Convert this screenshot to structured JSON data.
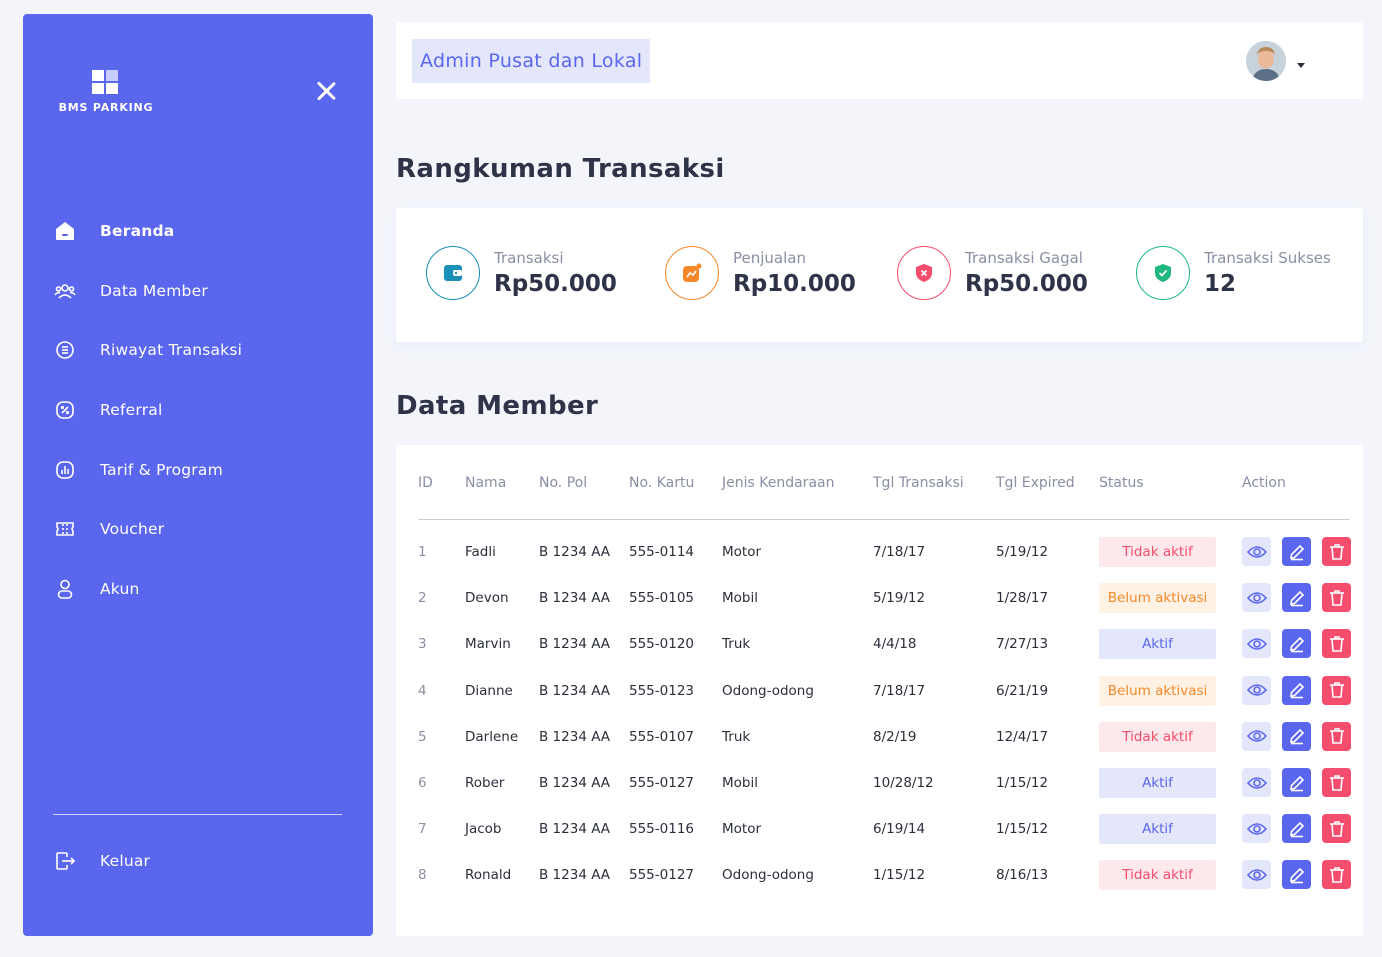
{
  "sidebar": {
    "brand": "BMS PARKING",
    "items": [
      {
        "label": "Beranda",
        "icon": "home-icon"
      },
      {
        "label": "Data Member",
        "icon": "users-icon"
      },
      {
        "label": "Riwayat Transaksi",
        "icon": "history-icon"
      },
      {
        "label": "Referral",
        "icon": "percent-icon"
      },
      {
        "label": "Tarif & Program",
        "icon": "chart-icon"
      },
      {
        "label": "Voucher",
        "icon": "ticket-icon"
      },
      {
        "label": "Akun",
        "icon": "user-icon"
      }
    ],
    "active_item": "Beranda",
    "logout_label": "Keluar"
  },
  "header": {
    "title": "Admin Pusat dan Lokal"
  },
  "summary": {
    "title": "Rangkuman Transaksi",
    "cards": [
      {
        "label": "Transaksi",
        "value": "Rp50.000",
        "icon": "wallet-icon",
        "color": "#1a8fb8"
      },
      {
        "label": "Penjualan",
        "value": "Rp10.000",
        "icon": "sales-chart-icon",
        "color": "#f6882a"
      },
      {
        "label": "Transaksi Gagal",
        "value": "Rp50.000",
        "icon": "shield-x-icon",
        "color": "#f44d6e"
      },
      {
        "label": "Transaksi Sukses",
        "value": "12",
        "icon": "shield-check-icon",
        "color": "#1fb980"
      }
    ]
  },
  "members": {
    "title": "Data Member",
    "columns": [
      "ID",
      "Nama",
      "No. Pol",
      "No. Kartu",
      "Jenis Kendaraan",
      "Tgl Transaksi",
      "Tgl Expired",
      "Status",
      "Action"
    ],
    "rows": [
      {
        "id": "1",
        "nama": "Fadli",
        "nopol": "B 1234 AA",
        "kartu": "555-0114",
        "jenis": "Motor",
        "tgl_transaksi": "7/18/17",
        "tgl_expired": "5/19/12",
        "status": "Tidak aktif"
      },
      {
        "id": "2",
        "nama": "Devon",
        "nopol": "B 1234 AA",
        "kartu": "555-0105",
        "jenis": "Mobil",
        "tgl_transaksi": "5/19/12",
        "tgl_expired": "1/28/17",
        "status": "Belum aktivasi"
      },
      {
        "id": "3",
        "nama": "Marvin",
        "nopol": "B 1234 AA",
        "kartu": "555-0120",
        "jenis": "Truk",
        "tgl_transaksi": "4/4/18",
        "tgl_expired": "7/27/13",
        "status": "Aktif"
      },
      {
        "id": "4",
        "nama": "Dianne",
        "nopol": "B 1234 AA",
        "kartu": "555-0123",
        "jenis": "Odong-odong",
        "tgl_transaksi": "7/18/17",
        "tgl_expired": "6/21/19",
        "status": "Belum aktivasi"
      },
      {
        "id": "5",
        "nama": "Darlene",
        "nopol": "B 1234 AA",
        "kartu": "555-0107",
        "jenis": "Truk",
        "tgl_transaksi": "8/2/19",
        "tgl_expired": "12/4/17",
        "status": "Tidak aktif"
      },
      {
        "id": "6",
        "nama": "Rober",
        "nopol": "B 1234 AA",
        "kartu": "555-0127",
        "jenis": "Mobil",
        "tgl_transaksi": "10/28/12",
        "tgl_expired": "1/15/12",
        "status": "Aktif"
      },
      {
        "id": "7",
        "nama": "Jacob",
        "nopol": "B 1234 AA",
        "kartu": "555-0116",
        "jenis": "Motor",
        "tgl_transaksi": "6/19/14",
        "tgl_expired": "1/15/12",
        "status": "Aktif"
      },
      {
        "id": "8",
        "nama": "Ronald",
        "nopol": "B 1234 AA",
        "kartu": "555-0127",
        "jenis": "Odong-odong",
        "tgl_transaksi": "1/15/12",
        "tgl_expired": "8/16/13",
        "status": "Tidak aktif"
      }
    ],
    "status_colors": {
      "Tidak aktif": {
        "bg": "#fde8ec",
        "fg": "#f44d6e"
      },
      "Belum aktivasi": {
        "bg": "#fff1e4",
        "fg": "#f6882a"
      },
      "Aktif": {
        "bg": "#e4e7fb",
        "fg": "#5a66ee"
      }
    },
    "action_icons": [
      "eye-icon",
      "edit-icon",
      "trash-icon"
    ]
  },
  "colors": {
    "accent": "#5a66ee",
    "background": "#f3f5fb"
  }
}
